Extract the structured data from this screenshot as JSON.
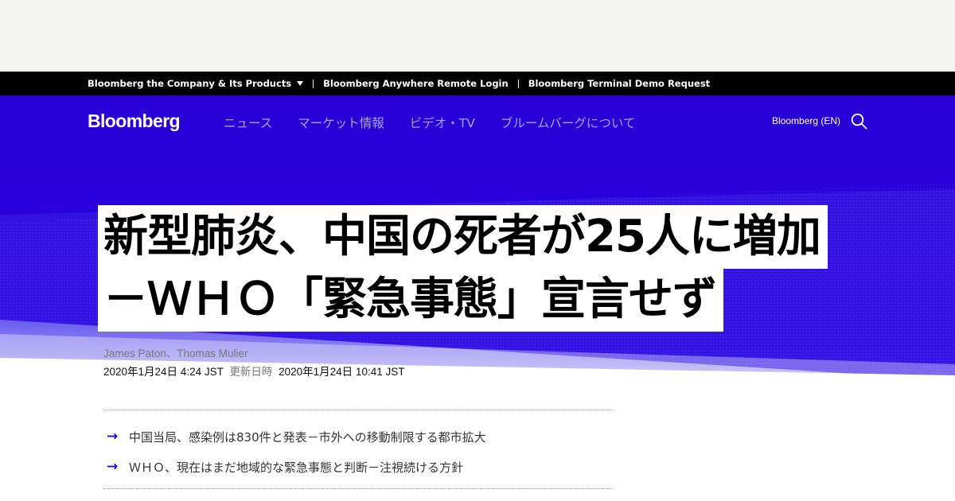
{
  "topbar": {
    "company_products": "Bloomberg the Company & Its Products",
    "anywhere_login": "Bloomberg Anywhere Remote Login",
    "terminal_demo": "Bloomberg Terminal Demo Request"
  },
  "header": {
    "logo": "Bloomberg",
    "nav": [
      "ニュース",
      "マーケット情報",
      "ビデオ・TV",
      "ブルームバーグについて"
    ],
    "edition": "Bloomberg (EN)"
  },
  "colors": {
    "brand_blue": "#2800d7",
    "nav_link": "#a7a4ff"
  },
  "article": {
    "headline_line1": "新型肺炎、中国の死者が25人に増加",
    "headline_line2": "－ＷＨＯ「緊急事態」宣言せず",
    "byline": "James Paton、Thomas Mulier",
    "published": "2020年1月24日 4:24 JST",
    "updated_label": "更新日時",
    "updated": "2020年1月24日 10:41 JST",
    "summary": [
      "中国当局、感染例は830件と発表－市外への移動制限する都市拡大",
      "ＷＨＯ、現在はまだ地域的な緊急事態と判断－注視続ける方針"
    ]
  }
}
